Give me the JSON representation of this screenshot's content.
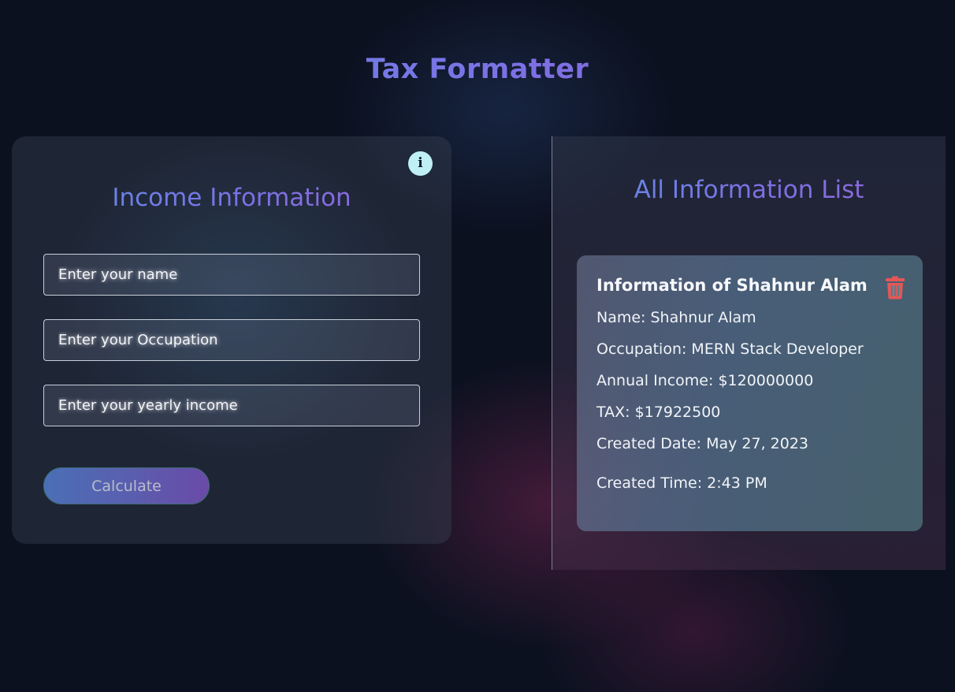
{
  "app": {
    "title": "Tax Formatter"
  },
  "income_form": {
    "title": "Income Information",
    "info_icon_glyph": "i",
    "name_placeholder": "Enter your name",
    "occupation_placeholder": "Enter your Occupation",
    "income_placeholder": "Enter your yearly income",
    "calculate_label": "Calculate"
  },
  "info_list": {
    "title": "All Information List",
    "records": [
      {
        "heading": "Information of Shahnur Alam",
        "name_line": "Name: Shahnur Alam",
        "occupation_line": "Occupation: MERN Stack Developer",
        "income_line": "Annual Income: $120000000",
        "tax_line": "TAX: $17922500",
        "date_line": "Created Date: May 27, 2023",
        "time_line": "Created Time: 2:43 PM",
        "delete_icon": "trash-icon"
      }
    ]
  },
  "colors": {
    "background": "#0c1120",
    "title_gradient": [
      "#5f8ee6",
      "#9265d6"
    ],
    "info_icon_bg": "#bff0f6",
    "delete_icon": "#e55757"
  }
}
